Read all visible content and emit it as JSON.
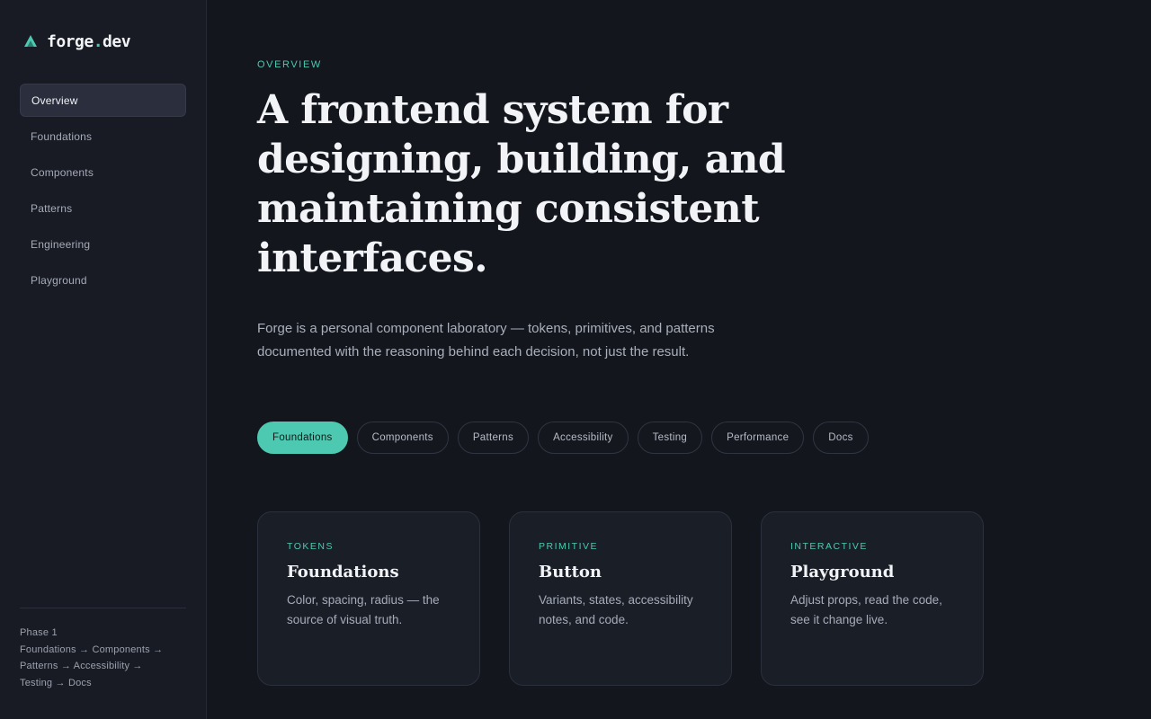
{
  "brand": {
    "name": "forge",
    "dot": ".",
    "tld": "dev",
    "icon": "forge-logo-icon",
    "accent": "#4cc9b0"
  },
  "sidebar": {
    "items": [
      {
        "label": "Overview",
        "active": true
      },
      {
        "label": "Foundations"
      },
      {
        "label": "Components"
      },
      {
        "label": "Patterns"
      },
      {
        "label": "Engineering"
      },
      {
        "label": "Playground"
      }
    ],
    "footer": {
      "phase": "Phase 1",
      "line1": "Foundations → Components →",
      "line2": "Patterns → Accessibility →",
      "line3": "Testing → Docs"
    }
  },
  "main": {
    "eyebrow": "Overview",
    "headline": "A frontend system for designing, building, and maintaining consistent interfaces.",
    "lede": "Forge is a personal component laboratory — tokens, primitives, and patterns documented with the reasoning behind each decision, not just the result.",
    "chips": [
      {
        "label": "Foundations",
        "active": true
      },
      {
        "label": "Components"
      },
      {
        "label": "Patterns"
      },
      {
        "label": "Accessibility"
      },
      {
        "label": "Testing"
      },
      {
        "label": "Performance"
      },
      {
        "label": "Docs"
      }
    ],
    "cards": [
      {
        "tag": "Tokens",
        "title": "Foundations",
        "desc": "Color, spacing, radius — the source of visual truth."
      },
      {
        "tag": "Primitive",
        "title": "Button",
        "desc": "Variants, states, accessibility notes, and code."
      },
      {
        "tag": "Interactive",
        "title": "Playground",
        "desc": "Adjust props, read the code, see it change live."
      }
    ]
  }
}
